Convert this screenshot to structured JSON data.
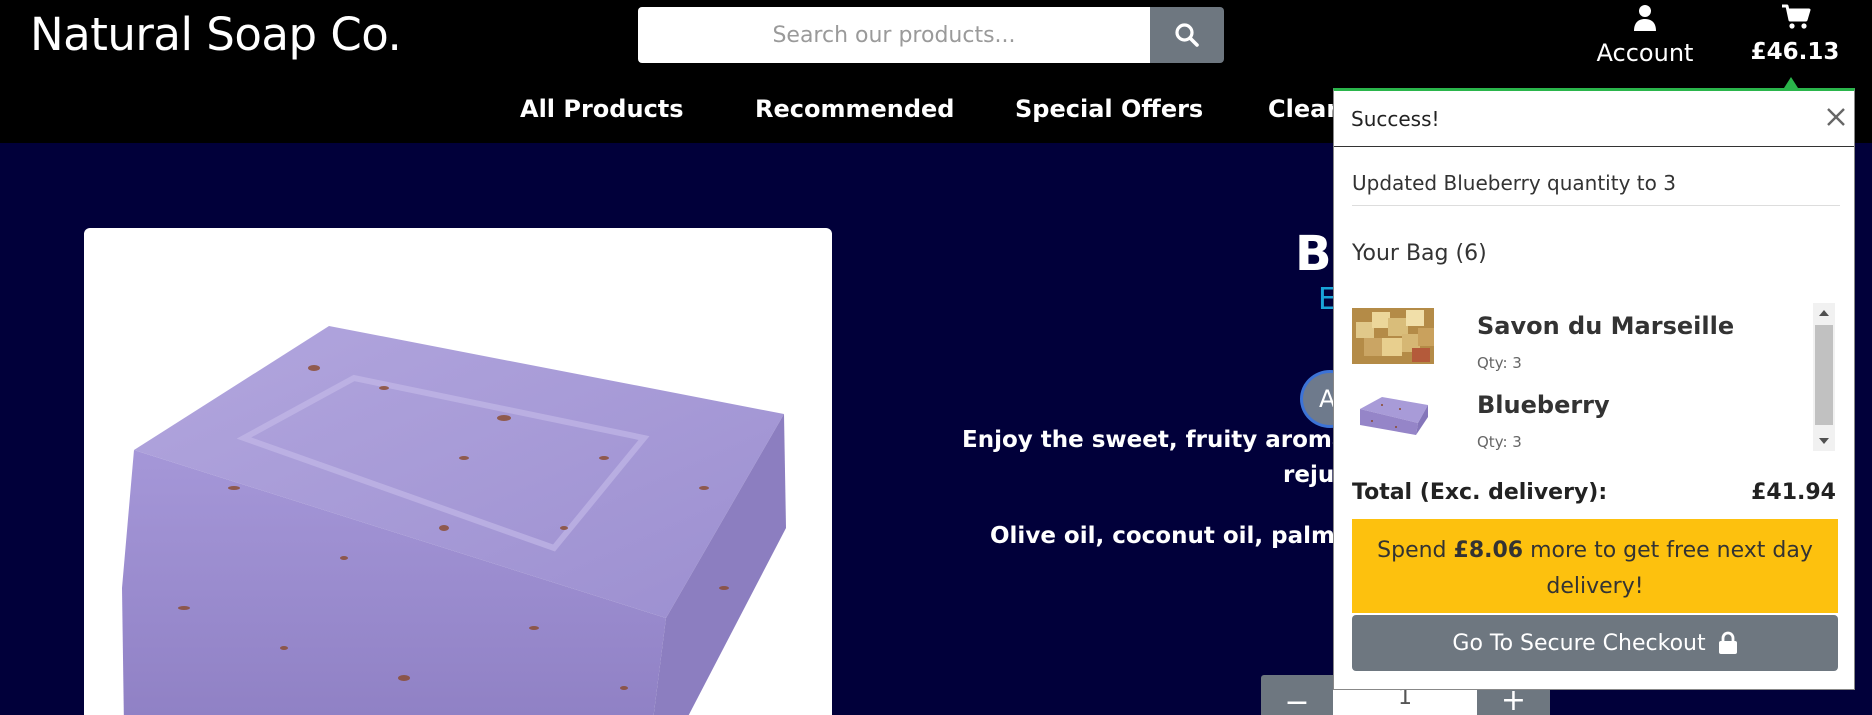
{
  "header": {
    "brand": "Natural Soap Co.",
    "search": {
      "placeholder": "Search our products..."
    },
    "account_label": "Account",
    "bag_total": "£46.13"
  },
  "nav": {
    "items": [
      {
        "label": "All Products"
      },
      {
        "label": "Recommended"
      },
      {
        "label": "Special Offers"
      },
      {
        "label": "Cleara"
      }
    ]
  },
  "product": {
    "title": "Bl",
    "subtitle": "E",
    "tag_letter": "A",
    "description_line1": "Enjoy the sweet, fruity aroma of c",
    "description_line2": "rejuv",
    "ingredients_partial": "Olive oil, coconut oil, palm oil,",
    "quantity": "1",
    "minus_label": "−",
    "plus_label": "+"
  },
  "popup": {
    "title": "Success!",
    "message": "Updated Blueberry quantity to 3",
    "bag_title": "Your Bag (6)",
    "items": [
      {
        "name": "Savon du Marseille",
        "qty": "Qty: 3"
      },
      {
        "name": "Blueberry",
        "qty": "Qty: 3"
      }
    ],
    "total_label": "Total (Exc. delivery):",
    "total_value": "£41.94",
    "promo": {
      "prefix": "Spend ",
      "amount": "£8.06",
      "suffix": " more to get free next day delivery!"
    },
    "checkout_label": "Go To Secure Checkout"
  },
  "colors": {
    "background": "#01003a",
    "header": "#000000",
    "accent_green": "#2ab54b",
    "promo_yellow": "#fdc10e",
    "button_grey": "#6e7780",
    "subtitle_blue": "#19a4d8"
  },
  "icons": [
    "search-icon",
    "user-icon",
    "cart-icon",
    "close-icon",
    "lock-icon",
    "chevron-up-icon",
    "chevron-down-icon"
  ]
}
